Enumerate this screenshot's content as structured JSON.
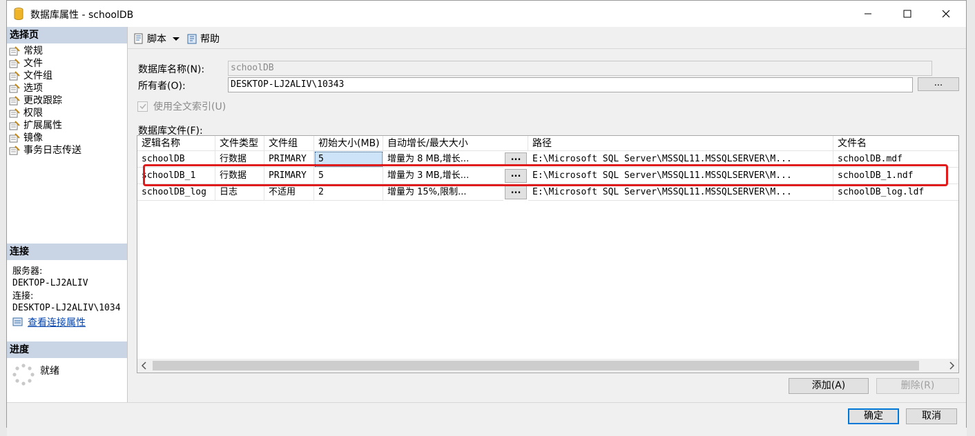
{
  "window": {
    "title": "数据库属性 - schoolDB"
  },
  "left": {
    "select_page_header": "选择页",
    "pages": [
      "常规",
      "文件",
      "文件组",
      "选项",
      "更改跟踪",
      "权限",
      "扩展属性",
      "镜像",
      "事务日志传送"
    ],
    "connection_header": "连接",
    "server_label": "服务器:",
    "server_value": "DEKTOP-LJ2ALIV",
    "connection_label": "连接:",
    "connection_value": "DESKTOP-LJ2ALIV\\1034",
    "view_connection_props": "查看连接属性",
    "progress_header": "进度",
    "progress_status": "就绪"
  },
  "toolbar": {
    "script_label": "脚本",
    "help_label": "帮助"
  },
  "form": {
    "dbname_label": "数据库名称(N):",
    "dbname_value": "schoolDB",
    "owner_label": "所有者(O):",
    "owner_value": "DESKTOP-LJ2ALIV\\10343",
    "browse_label": "...",
    "fulltext_label": "使用全文索引(U)",
    "files_label": "数据库文件(F):"
  },
  "grid": {
    "columns": [
      "逻辑名称",
      "文件类型",
      "文件组",
      "初始大小(MB)",
      "自动增长/最大大小",
      "路径",
      "文件名"
    ],
    "rows": [
      [
        "schoolDB",
        "行数据",
        "PRIMARY",
        "5",
        "增量为 8 MB,增长...",
        "E:\\Microsoft SQL Server\\MSSQL11.MSSQLSERVER\\M...",
        "schoolDB.mdf"
      ],
      [
        "schoolDB_1",
        "行数据",
        "PRIMARY",
        "5",
        "增量为 3 MB,增长...",
        "E:\\Microsoft SQL Server\\MSSQL11.MSSQLSERVER\\M...",
        "schoolDB_1.ndf"
      ],
      [
        "schoolDB_log",
        "日志",
        "不适用",
        "2",
        "增量为 15%,限制...",
        "E:\\Microsoft SQL Server\\MSSQL11.MSSQLSERVER\\M...",
        "schoolDB_log.ldf"
      ]
    ],
    "ellipsis": "..."
  },
  "buttons": {
    "add": "添加(A)",
    "remove": "删除(R)",
    "ok": "确定",
    "cancel": "取消"
  },
  "colors": {
    "header_band": "#c9d4e5",
    "highlight": "#e01b1b",
    "selection": "#cde3f7",
    "link": "#0645ad"
  }
}
